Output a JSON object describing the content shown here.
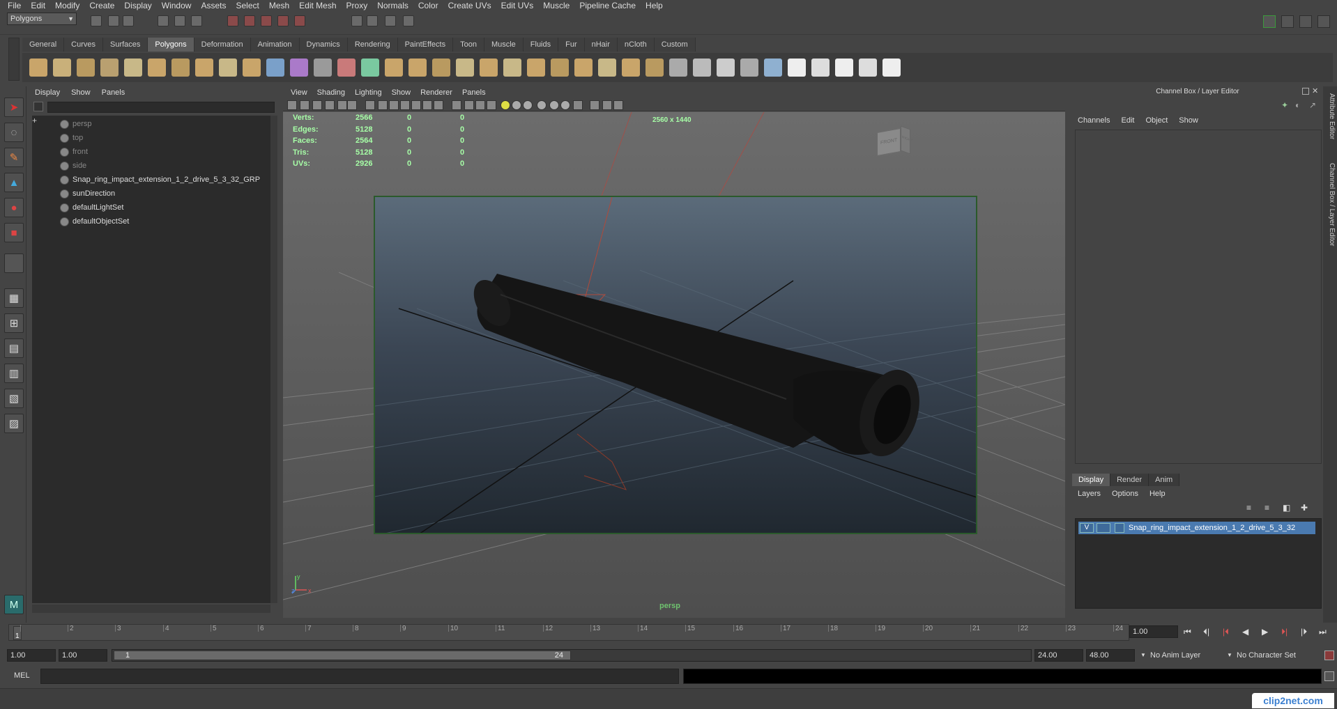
{
  "menubar": [
    "File",
    "Edit",
    "Modify",
    "Create",
    "Display",
    "Window",
    "Assets",
    "Select",
    "Mesh",
    "Edit Mesh",
    "Proxy",
    "Normals",
    "Color",
    "Create UVs",
    "Edit UVs",
    "Muscle",
    "Pipeline Cache",
    "Help"
  ],
  "status_line": {
    "mode": "Polygons"
  },
  "shelf_tabs": [
    "General",
    "Curves",
    "Surfaces",
    "Polygons",
    "Deformation",
    "Animation",
    "Dynamics",
    "Rendering",
    "PaintEffects",
    "Toon",
    "Muscle",
    "Fluids",
    "Fur",
    "nHair",
    "nCloth",
    "Custom"
  ],
  "shelf_active_tab": "Polygons",
  "outliner": {
    "menu": [
      "Display",
      "Show",
      "Panels"
    ],
    "items": [
      {
        "label": "persp",
        "dim": true
      },
      {
        "label": "top",
        "dim": true
      },
      {
        "label": "front",
        "dim": true
      },
      {
        "label": "side",
        "dim": true
      },
      {
        "label": "Snap_ring_impact_extension_1_2_drive_5_3_32_GRP",
        "dim": false
      },
      {
        "label": "sunDirection",
        "dim": false
      },
      {
        "label": "defaultLightSet",
        "dim": false,
        "expandable": true
      },
      {
        "label": "defaultObjectSet",
        "dim": false
      }
    ]
  },
  "viewport": {
    "menu": [
      "View",
      "Shading",
      "Lighting",
      "Show",
      "Renderer",
      "Panels"
    ],
    "hud": {
      "rows": [
        {
          "label": "Verts:",
          "v1": "2566",
          "v2": "0",
          "v3": "0"
        },
        {
          "label": "Edges:",
          "v1": "5128",
          "v2": "0",
          "v3": "0"
        },
        {
          "label": "Faces:",
          "v1": "2564",
          "v2": "0",
          "v3": "0"
        },
        {
          "label": "Tris:",
          "v1": "5128",
          "v2": "0",
          "v3": "0"
        },
        {
          "label": "UVs:",
          "v1": "2926",
          "v2": "0",
          "v3": "0"
        }
      ],
      "resolution": "2560 x 1440"
    },
    "camera": "persp",
    "viewcube_front": "FRONT",
    "viewcube_right": "RIGHT",
    "axis_labels": [
      "y",
      "z",
      "x"
    ]
  },
  "channel_box": {
    "title": "Channel Box / Layer Editor",
    "menu": [
      "Channels",
      "Edit",
      "Object",
      "Show"
    ]
  },
  "layer_editor": {
    "tabs": [
      "Display",
      "Render",
      "Anim"
    ],
    "active_tab": "Display",
    "menu": [
      "Layers",
      "Options",
      "Help"
    ],
    "layer": {
      "visible": "V",
      "name": "Snap_ring_impact_extension_1_2_drive_5_3_32"
    }
  },
  "side_tabs": [
    "Attribute Editor",
    "Channel Box / Layer Editor"
  ],
  "time_slider": {
    "ticks": [
      1,
      2,
      3,
      4,
      5,
      6,
      7,
      8,
      9,
      10,
      11,
      12,
      13,
      14,
      15,
      16,
      17,
      18,
      19,
      20,
      21,
      22,
      23,
      24
    ],
    "current_frame": "1",
    "current_time": "1.00"
  },
  "range_slider": {
    "start_time": "1.00",
    "playback_start": "1.00",
    "range_start_label": "1",
    "range_end_label": "24",
    "playback_end": "24.00",
    "end_time": "48.00",
    "anim_layer": "No Anim Layer",
    "character_set": "No Character Set"
  },
  "command_line": {
    "label": "MEL"
  },
  "watermark": "clip2net.com",
  "colors": {
    "hud_text": "#a7ffa7",
    "selection": "#4a7ab0",
    "gate_border": "#2b5a2b"
  }
}
